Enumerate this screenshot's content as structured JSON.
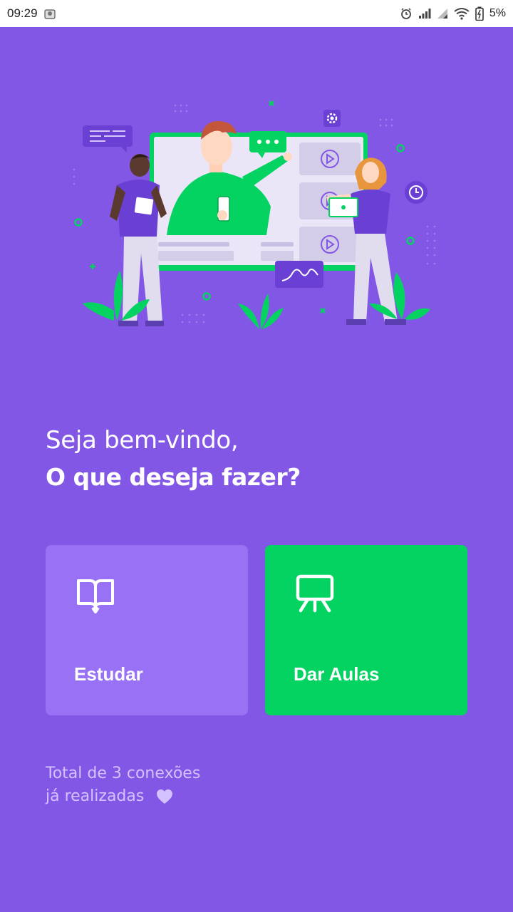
{
  "status_bar": {
    "time": "09:29",
    "battery": "5%"
  },
  "greeting": {
    "line1": "Seja bem-vindo,",
    "line2": "O que deseja fazer?"
  },
  "buttons": {
    "study_label": "Estudar",
    "teach_label": "Dar Aulas"
  },
  "connections": {
    "line1": "Total de 3 conexões",
    "line2": "já realizadas"
  },
  "colors": {
    "background": "#8257e5",
    "study_card": "#9871f5",
    "teach_card": "#04d361",
    "connections_text": "#d4c2ff"
  },
  "icons": {
    "study": "book-open-icon",
    "teach": "presentation-board-icon",
    "heart": "purple-heart-icon"
  }
}
